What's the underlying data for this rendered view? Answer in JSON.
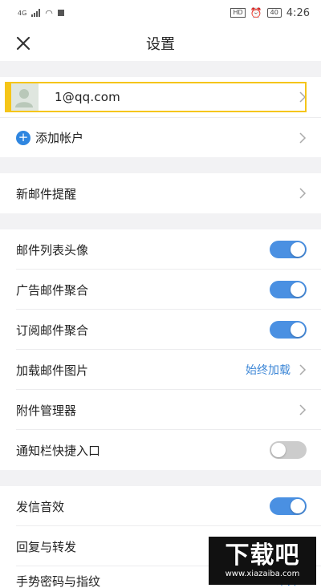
{
  "status_bar": {
    "network": "4G",
    "time": "4:26",
    "hd": "HD",
    "battery": "40"
  },
  "header": {
    "title": "设置"
  },
  "account": {
    "email": "1@qq.com",
    "add_label": "添加帐户"
  },
  "section_notify": {
    "new_mail_reminder": "新邮件提醒"
  },
  "section_display": [
    {
      "label": "邮件列表头像",
      "type": "toggle",
      "on": true
    },
    {
      "label": "广告邮件聚合",
      "type": "toggle",
      "on": true
    },
    {
      "label": "订阅邮件聚合",
      "type": "toggle",
      "on": true
    },
    {
      "label": "加载邮件图片",
      "type": "value",
      "value": "始终加载"
    },
    {
      "label": "附件管理器",
      "type": "chevron"
    },
    {
      "label": "通知栏快捷入口",
      "type": "toggle",
      "on": false
    }
  ],
  "section_misc": [
    {
      "label": "发信音效",
      "type": "toggle",
      "on": true
    },
    {
      "label": "回复与转发",
      "type": "chevron"
    },
    {
      "label": "手势密码与指纹",
      "type": "value",
      "value": "未开"
    }
  ],
  "watermark": {
    "brand": "下载吧",
    "url": "www.xiazaiba.com"
  },
  "colors": {
    "accent": "#4a90e2",
    "highlight": "#f5c518",
    "link": "#3c86d6"
  }
}
